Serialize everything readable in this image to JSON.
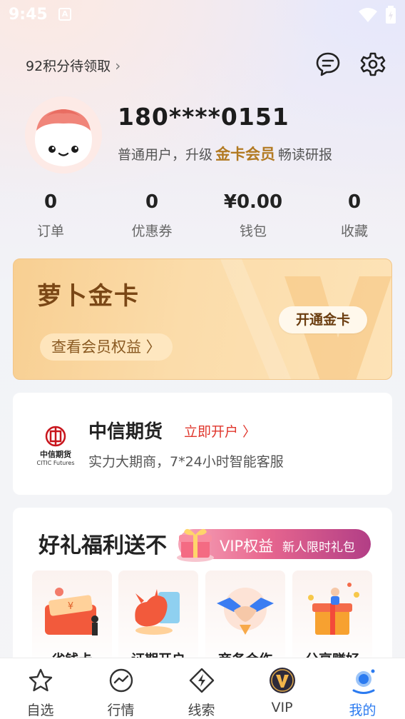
{
  "status_bar": {
    "time": "9:45",
    "notification_badge": "A"
  },
  "header": {
    "points_text": "92积分待领取",
    "message_icon": "chat-bubble-icon",
    "settings_icon": "gear-icon"
  },
  "profile": {
    "phone": "180****0151",
    "member_prefix": "普通用户，升级",
    "member_highlight": "金卡会员",
    "member_suffix": "畅读研报"
  },
  "stats": [
    {
      "value": "0",
      "label": "订单"
    },
    {
      "value": "0",
      "label": "优惠券"
    },
    {
      "value": "¥0.00",
      "label": "钱包"
    },
    {
      "value": "0",
      "label": "收藏"
    }
  ],
  "gold_card": {
    "title": "萝卜金卡",
    "link_label": "查看会员权益 〉",
    "button_label": "开通金卡"
  },
  "citic": {
    "logo_cn": "中信期货",
    "logo_en": "CITIC Futures",
    "name": "中信期货",
    "open_label": "立即开户 〉",
    "description": "实力大期商，7*24小时智能客服"
  },
  "benefits": {
    "title": "好礼福利送不",
    "vip_label": "VIP权益",
    "vip_sub": "新人限时礼包",
    "tiles": [
      {
        "label": "省钱卡"
      },
      {
        "label": "证期开户"
      },
      {
        "label": "商务合作"
      },
      {
        "label": "分享赚好"
      }
    ]
  },
  "tabbar": {
    "tabs": [
      {
        "label": "自选",
        "icon": "star-icon"
      },
      {
        "label": "行情",
        "icon": "chart-circle-icon"
      },
      {
        "label": "线索",
        "icon": "bolt-diamond-icon"
      },
      {
        "label": "VIP",
        "icon": "vip-badge-icon"
      },
      {
        "label": "我的",
        "icon": "profile-icon"
      }
    ],
    "active_index": 4
  },
  "colors": {
    "accent_blue": "#2c7bf0",
    "gold_text": "#b27a22",
    "open_red": "#e0362c"
  }
}
